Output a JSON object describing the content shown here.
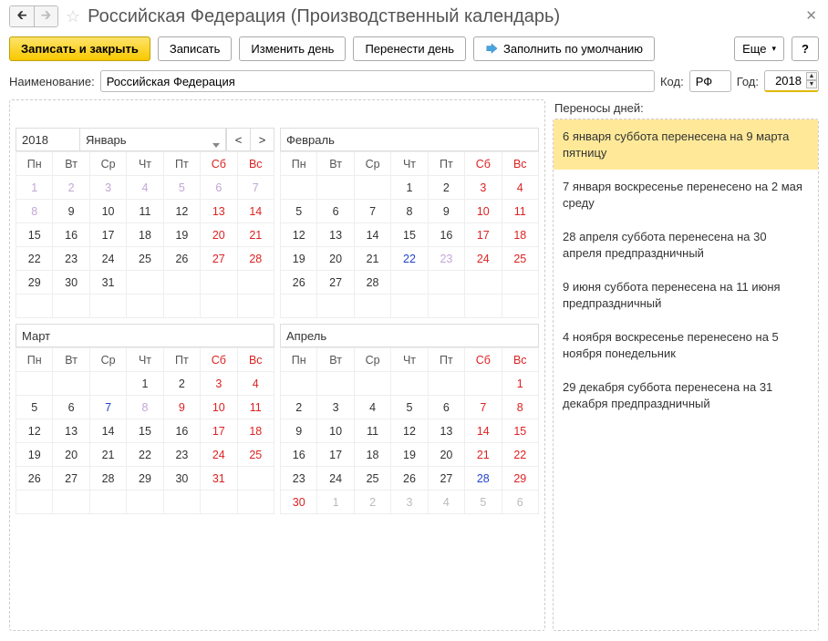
{
  "title": "Российская Федерация (Производственный календарь)",
  "toolbar": {
    "save_close": "Записать и закрыть",
    "save": "Записать",
    "change_day": "Изменить день",
    "move_day": "Перенести день",
    "fill_default": "Заполнить по умолчанию",
    "more": "Еще",
    "help": "?"
  },
  "labels": {
    "name": "Наименование:",
    "code": "Код:",
    "year": "Год:",
    "transfers_title": "Переносы дней:"
  },
  "form": {
    "name": "Российская Федерация",
    "code": "РФ",
    "year": "2018"
  },
  "calendar": {
    "year_label": "2018",
    "weekdays": [
      "Пн",
      "Вт",
      "Ср",
      "Чт",
      "Пт",
      "Сб",
      "Вс"
    ],
    "months": [
      {
        "name": "Январь",
        "first": true,
        "show_year": true,
        "prev_nav": "<",
        "next_nav": ">",
        "rows": [
          [
            {
              "d": "1",
              "c": "hl"
            },
            {
              "d": "2",
              "c": "hl"
            },
            {
              "d": "3",
              "c": "hl"
            },
            {
              "d": "4",
              "c": "hl"
            },
            {
              "d": "5",
              "c": "hl"
            },
            {
              "d": "6",
              "c": "hl"
            },
            {
              "d": "7",
              "c": "hl"
            }
          ],
          [
            {
              "d": "8",
              "c": "hl"
            },
            {
              "d": "9"
            },
            {
              "d": "10"
            },
            {
              "d": "11"
            },
            {
              "d": "12"
            },
            {
              "d": "13",
              "c": "wk"
            },
            {
              "d": "14",
              "c": "wk"
            }
          ],
          [
            {
              "d": "15"
            },
            {
              "d": "16"
            },
            {
              "d": "17"
            },
            {
              "d": "18"
            },
            {
              "d": "19"
            },
            {
              "d": "20",
              "c": "wk"
            },
            {
              "d": "21",
              "c": "wk"
            }
          ],
          [
            {
              "d": "22"
            },
            {
              "d": "23"
            },
            {
              "d": "24"
            },
            {
              "d": "25"
            },
            {
              "d": "26"
            },
            {
              "d": "27",
              "c": "wk"
            },
            {
              "d": "28",
              "c": "wk"
            }
          ],
          [
            {
              "d": "29"
            },
            {
              "d": "30"
            },
            {
              "d": "31"
            },
            {
              "d": ""
            },
            {
              "d": ""
            },
            {
              "d": ""
            },
            {
              "d": ""
            }
          ],
          [
            {
              "d": ""
            },
            {
              "d": ""
            },
            {
              "d": ""
            },
            {
              "d": ""
            },
            {
              "d": ""
            },
            {
              "d": ""
            },
            {
              "d": ""
            }
          ]
        ]
      },
      {
        "name": "Февраль",
        "rows": [
          [
            {
              "d": ""
            },
            {
              "d": ""
            },
            {
              "d": ""
            },
            {
              "d": "1"
            },
            {
              "d": "2"
            },
            {
              "d": "3",
              "c": "wk"
            },
            {
              "d": "4",
              "c": "wk"
            }
          ],
          [
            {
              "d": "5"
            },
            {
              "d": "6"
            },
            {
              "d": "7"
            },
            {
              "d": "8"
            },
            {
              "d": "9"
            },
            {
              "d": "10",
              "c": "wk"
            },
            {
              "d": "11",
              "c": "wk"
            }
          ],
          [
            {
              "d": "12"
            },
            {
              "d": "13"
            },
            {
              "d": "14"
            },
            {
              "d": "15"
            },
            {
              "d": "16"
            },
            {
              "d": "17",
              "c": "wk"
            },
            {
              "d": "18",
              "c": "wk"
            }
          ],
          [
            {
              "d": "19"
            },
            {
              "d": "20"
            },
            {
              "d": "21"
            },
            {
              "d": "22",
              "c": "sh"
            },
            {
              "d": "23",
              "c": "hl"
            },
            {
              "d": "24",
              "c": "wk"
            },
            {
              "d": "25",
              "c": "wk"
            }
          ],
          [
            {
              "d": "26"
            },
            {
              "d": "27"
            },
            {
              "d": "28"
            },
            {
              "d": ""
            },
            {
              "d": ""
            },
            {
              "d": ""
            },
            {
              "d": ""
            }
          ],
          [
            {
              "d": ""
            },
            {
              "d": ""
            },
            {
              "d": ""
            },
            {
              "d": ""
            },
            {
              "d": ""
            },
            {
              "d": ""
            },
            {
              "d": ""
            }
          ]
        ]
      },
      {
        "name": "Март",
        "rows": [
          [
            {
              "d": ""
            },
            {
              "d": ""
            },
            {
              "d": ""
            },
            {
              "d": "1"
            },
            {
              "d": "2"
            },
            {
              "d": "3",
              "c": "wk"
            },
            {
              "d": "4",
              "c": "wk"
            }
          ],
          [
            {
              "d": "5"
            },
            {
              "d": "6"
            },
            {
              "d": "7",
              "c": "sh"
            },
            {
              "d": "8",
              "c": "hl"
            },
            {
              "d": "9",
              "c": "wk"
            },
            {
              "d": "10",
              "c": "wk"
            },
            {
              "d": "11",
              "c": "wk"
            }
          ],
          [
            {
              "d": "12"
            },
            {
              "d": "13"
            },
            {
              "d": "14"
            },
            {
              "d": "15"
            },
            {
              "d": "16"
            },
            {
              "d": "17",
              "c": "wk"
            },
            {
              "d": "18",
              "c": "wk"
            }
          ],
          [
            {
              "d": "19"
            },
            {
              "d": "20"
            },
            {
              "d": "21"
            },
            {
              "d": "22"
            },
            {
              "d": "23"
            },
            {
              "d": "24",
              "c": "wk"
            },
            {
              "d": "25",
              "c": "wk"
            }
          ],
          [
            {
              "d": "26"
            },
            {
              "d": "27"
            },
            {
              "d": "28"
            },
            {
              "d": "29"
            },
            {
              "d": "30"
            },
            {
              "d": "31",
              "c": "wk"
            },
            {
              "d": ""
            }
          ],
          [
            {
              "d": ""
            },
            {
              "d": ""
            },
            {
              "d": ""
            },
            {
              "d": ""
            },
            {
              "d": ""
            },
            {
              "d": ""
            },
            {
              "d": ""
            }
          ]
        ]
      },
      {
        "name": "Апрель",
        "rows": [
          [
            {
              "d": ""
            },
            {
              "d": ""
            },
            {
              "d": ""
            },
            {
              "d": ""
            },
            {
              "d": ""
            },
            {
              "d": ""
            },
            {
              "d": "1",
              "c": "wk"
            }
          ],
          [
            {
              "d": "2"
            },
            {
              "d": "3"
            },
            {
              "d": "4"
            },
            {
              "d": "5"
            },
            {
              "d": "6"
            },
            {
              "d": "7",
              "c": "wk"
            },
            {
              "d": "8",
              "c": "wk"
            }
          ],
          [
            {
              "d": "9"
            },
            {
              "d": "10"
            },
            {
              "d": "11"
            },
            {
              "d": "12"
            },
            {
              "d": "13"
            },
            {
              "d": "14",
              "c": "wk"
            },
            {
              "d": "15",
              "c": "wk"
            }
          ],
          [
            {
              "d": "16"
            },
            {
              "d": "17"
            },
            {
              "d": "18"
            },
            {
              "d": "19"
            },
            {
              "d": "20"
            },
            {
              "d": "21",
              "c": "wk"
            },
            {
              "d": "22",
              "c": "wk"
            }
          ],
          [
            {
              "d": "23"
            },
            {
              "d": "24"
            },
            {
              "d": "25"
            },
            {
              "d": "26"
            },
            {
              "d": "27"
            },
            {
              "d": "28",
              "c": "sh"
            },
            {
              "d": "29",
              "c": "wk"
            }
          ],
          [
            {
              "d": "30",
              "c": "wk"
            },
            {
              "d": "1",
              "c": "ot"
            },
            {
              "d": "2",
              "c": "ot"
            },
            {
              "d": "3",
              "c": "ot"
            },
            {
              "d": "4",
              "c": "ot"
            },
            {
              "d": "5",
              "c": "ot"
            },
            {
              "d": "6",
              "c": "ot"
            }
          ]
        ]
      }
    ]
  },
  "transfers": [
    {
      "text": "6 января суббота перенесена на 9 марта пятницу",
      "selected": true
    },
    {
      "text": "7 января воскресенье перенесено на 2 мая среду"
    },
    {
      "text": "28 апреля суббота перенесена на 30 апреля предпраздничный"
    },
    {
      "text": "9 июня суббота перенесена на 11 июня предпраздничный"
    },
    {
      "text": "4 ноября воскресенье перенесено на 5 ноября понедельник"
    },
    {
      "text": "29 декабря суббота перенесена на 31 декабря предпраздничный"
    }
  ]
}
